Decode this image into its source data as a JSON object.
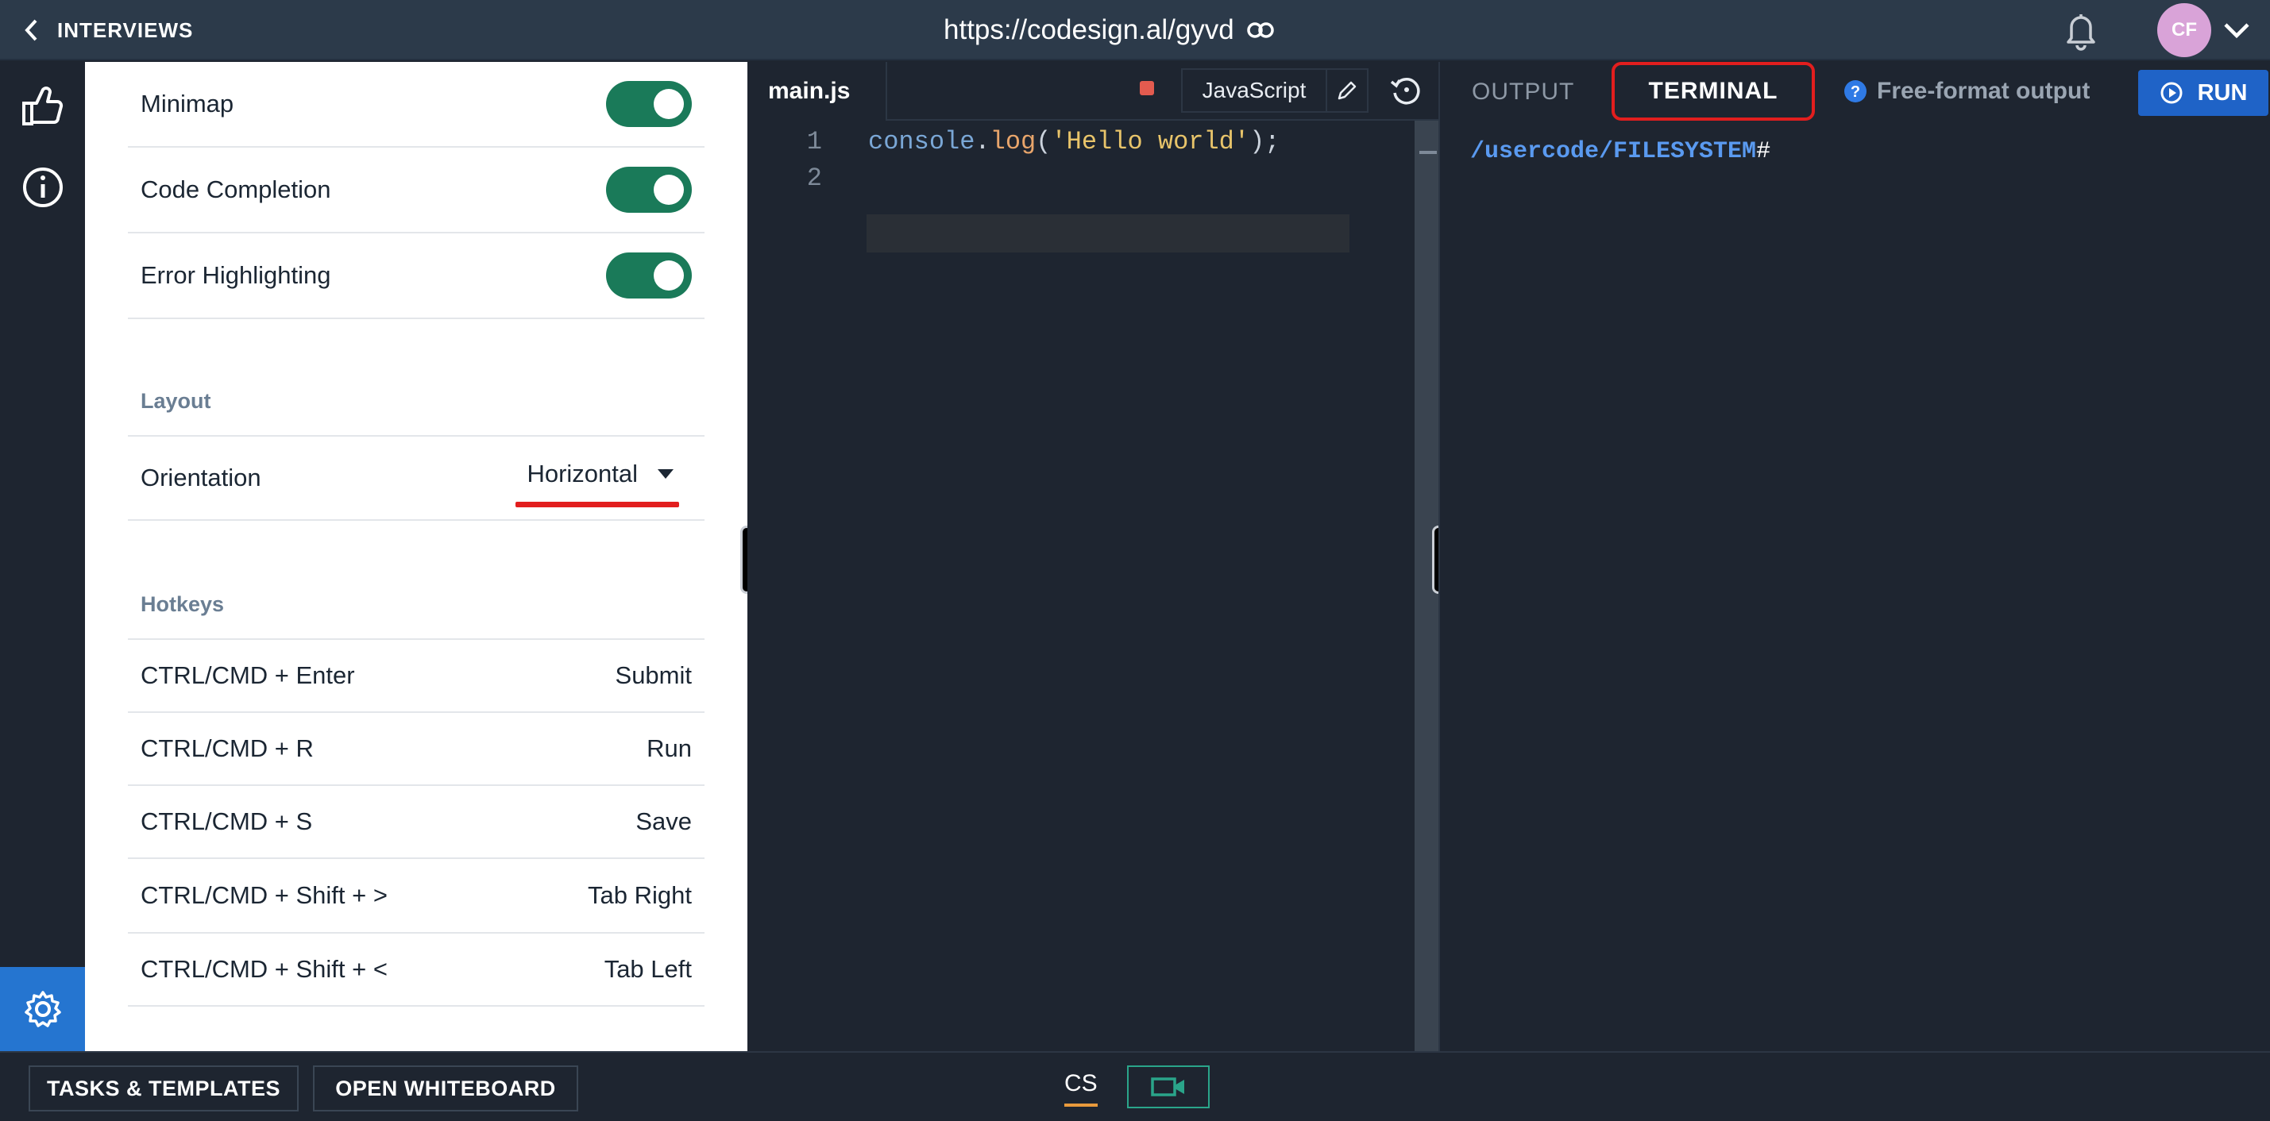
{
  "header": {
    "back_label": "INTERVIEWS",
    "url": "https://codesign.al/gyvd",
    "avatar_initials": "CF"
  },
  "settings": {
    "toggles": [
      {
        "label": "Minimap",
        "enabled": true
      },
      {
        "label": "Code Completion",
        "enabled": true
      },
      {
        "label": "Error Highlighting",
        "enabled": true
      }
    ],
    "layout_section": "Layout",
    "orientation_label": "Orientation",
    "orientation_value": "Horizontal",
    "hotkeys_section": "Hotkeys",
    "hotkeys": [
      {
        "keys": "CTRL/CMD + Enter",
        "action": "Submit"
      },
      {
        "keys": "CTRL/CMD + R",
        "action": "Run"
      },
      {
        "keys": "CTRL/CMD + S",
        "action": "Save"
      },
      {
        "keys": "CTRL/CMD + Shift + >",
        "action": "Tab Right"
      },
      {
        "keys": "CTRL/CMD + Shift + <",
        "action": "Tab Left"
      }
    ]
  },
  "editor": {
    "file_tab": "main.js",
    "language": "JavaScript",
    "line_numbers": [
      "1",
      "2"
    ],
    "code_line_1": {
      "obj": "console",
      "dot": ".",
      "fn": "log",
      "open": "(",
      "str": "'Hello world'",
      "close": ");"
    }
  },
  "output_panel": {
    "tab_output": "OUTPUT",
    "tab_terminal": "TERMINAL",
    "active_tab": "TERMINAL",
    "free_format": "Free-format output",
    "run_label": "RUN",
    "terminal_path": "/usercode/FILESYSTEM",
    "terminal_prompt": "#"
  },
  "footer": {
    "tasks_label": "TASKS & TEMPLATES",
    "whiteboard_label": "OPEN WHITEBOARD",
    "cs_label": "CS"
  },
  "colors": {
    "toggle_on": "#1a7a59",
    "run_button": "#1f63c7",
    "highlight_red": "#e21e1e",
    "settings_active": "#2575d0"
  }
}
